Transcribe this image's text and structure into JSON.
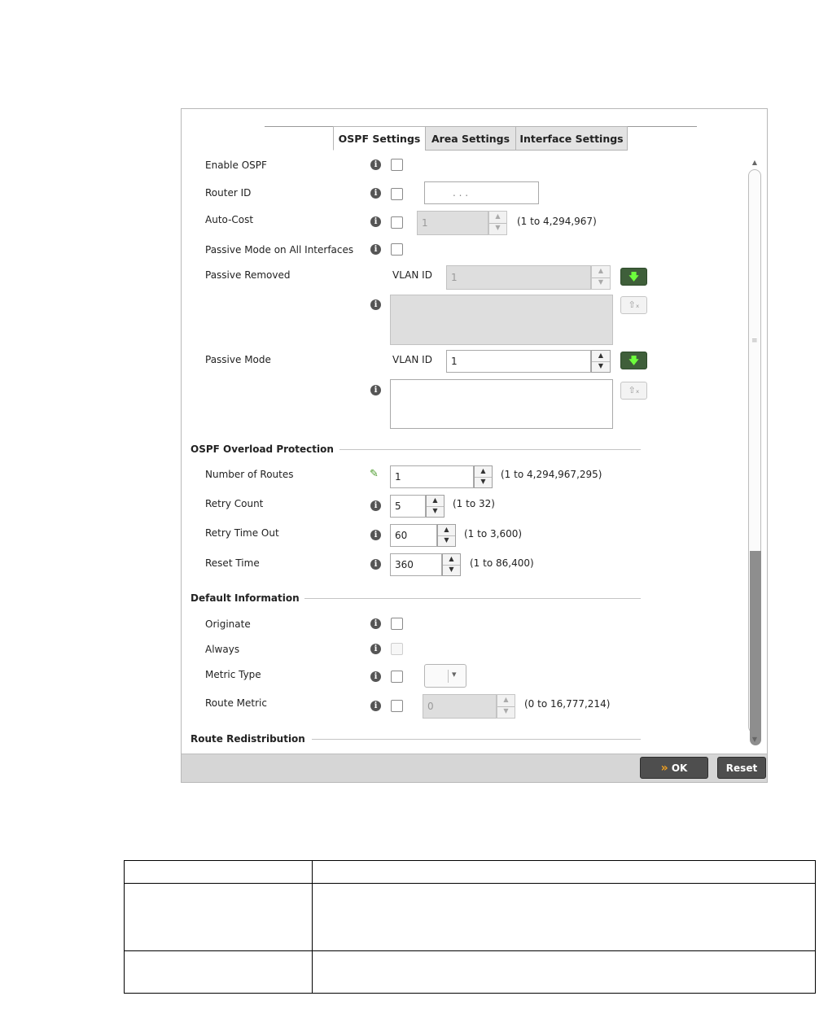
{
  "tabs": [
    {
      "label": "OSPF Settings",
      "active": true
    },
    {
      "label": "Area Settings",
      "active": false
    },
    {
      "label": "Interface Settings",
      "active": false
    }
  ],
  "icons": {
    "info": "i",
    "pencil": "✎",
    "up": "▲",
    "down": "▼",
    "add_arrow": "🡇",
    "erase": "⇧ₓ",
    "dropdown_caret": "▾",
    "ok_chevrons": "»"
  },
  "general": {
    "enable_ospf": "Enable OSPF",
    "router_id": "Router ID",
    "router_id_value": ".      .      .",
    "auto_cost": "Auto-Cost",
    "auto_cost_value": "1",
    "auto_cost_range": "(1 to 4,294,967)",
    "passive_all": "Passive Mode on All Interfaces",
    "passive_removed": "Passive Removed",
    "passive_removed_vlan_label": "VLAN ID",
    "passive_removed_vlan_value": "1",
    "passive_mode": "Passive Mode",
    "passive_mode_vlan_label": "VLAN ID",
    "passive_mode_vlan_value": "1"
  },
  "overload": {
    "title": "OSPF Overload Protection",
    "number_of_routes": "Number of Routes",
    "number_of_routes_value": "1",
    "number_of_routes_range": "(1 to 4,294,967,295)",
    "retry_count": "Retry Count",
    "retry_count_value": "5",
    "retry_count_range": "(1 to 32)",
    "retry_time_out": "Retry Time Out",
    "retry_time_out_value": "60",
    "retry_time_out_range": "(1 to 3,600)",
    "reset_time": "Reset Time",
    "reset_time_value": "360",
    "reset_time_range": "(1 to 86,400)"
  },
  "default_info": {
    "title": "Default Information",
    "originate": "Originate",
    "always": "Always",
    "metric_type": "Metric Type",
    "route_metric": "Route Metric",
    "route_metric_value": "0",
    "route_metric_range": "(0 to 16,777,214)"
  },
  "route_redistribution": {
    "title": "Route Redistribution"
  },
  "footer": {
    "ok_label": "OK",
    "reset_label": "Reset"
  },
  "colors": {
    "green_button": "#3f5f3a",
    "dark_button": "#4e4e4e",
    "ok_chevron": "#f0a020"
  }
}
